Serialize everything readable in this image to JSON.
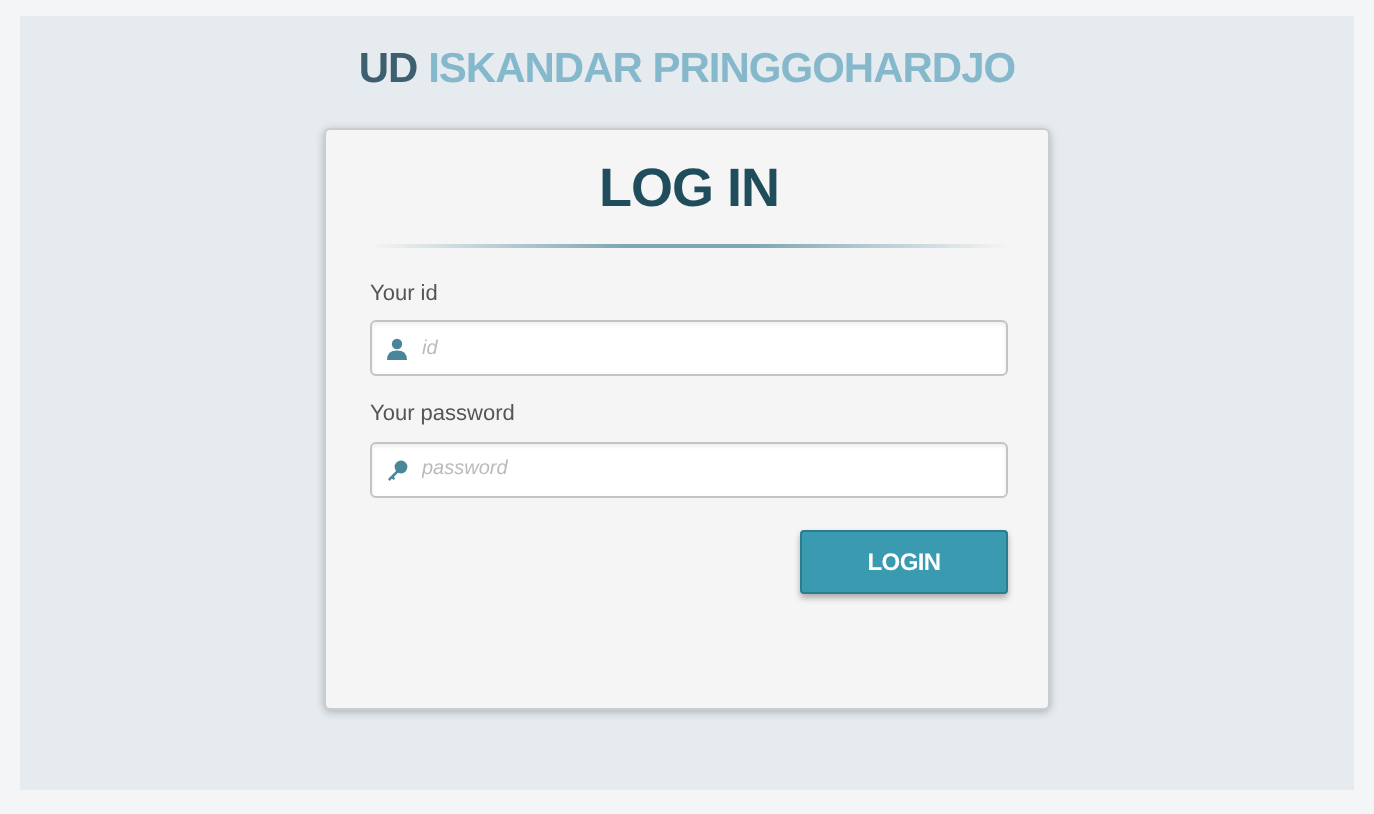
{
  "header": {
    "prefix": "UD",
    "name": "ISKANDAR PRINGGOHARDJO"
  },
  "login_card": {
    "title": "LOG IN",
    "fields": [
      {
        "label": "Your id",
        "placeholder": "id",
        "kind": "user"
      },
      {
        "label": "Your password",
        "placeholder": "password",
        "kind": "password"
      }
    ],
    "button": "LOGIN"
  }
}
